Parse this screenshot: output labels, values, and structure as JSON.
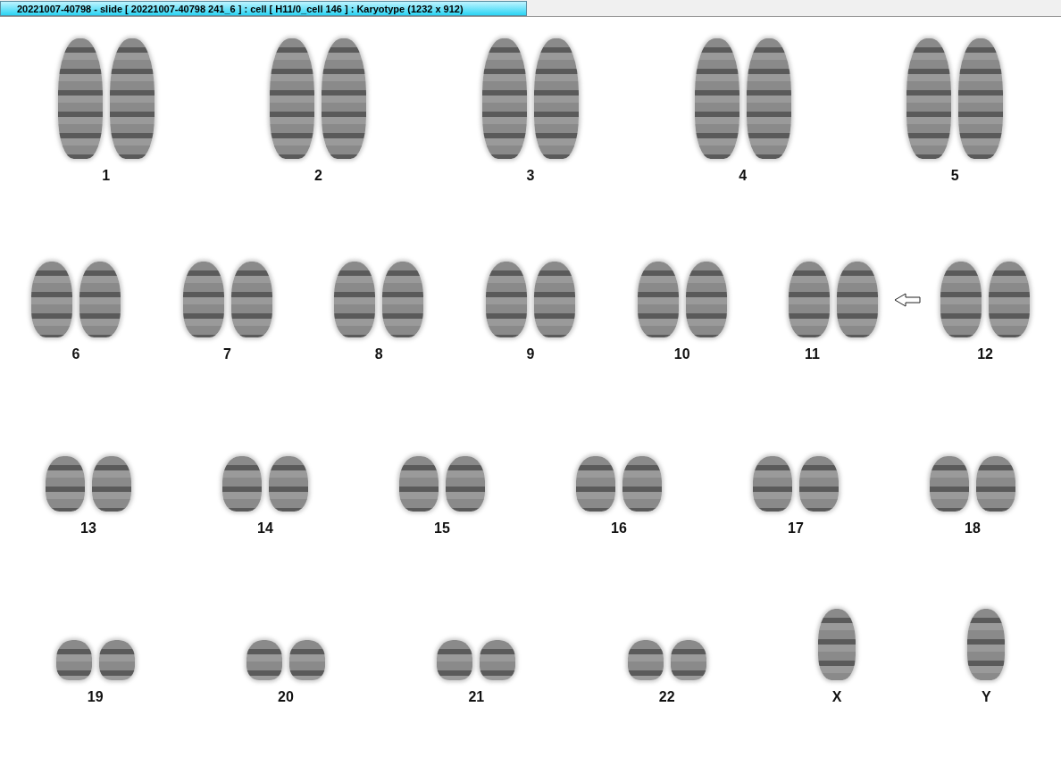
{
  "window": {
    "title": "20221007-40798 - slide [ 20221007-40798 241_6 ] : cell [ H11/0_cell 146 ] : Karyotype  (1232 x 912)"
  },
  "rows": [
    {
      "items": [
        {
          "label": "1",
          "kind": "pair",
          "marked": false
        },
        {
          "label": "2",
          "kind": "pair",
          "marked": false
        },
        {
          "label": "3",
          "kind": "pair",
          "marked": false
        },
        {
          "label": "4",
          "kind": "pair",
          "marked": false
        },
        {
          "label": "5",
          "kind": "pair",
          "marked": false
        }
      ]
    },
    {
      "items": [
        {
          "label": "6",
          "kind": "pair",
          "marked": false
        },
        {
          "label": "7",
          "kind": "pair",
          "marked": false
        },
        {
          "label": "8",
          "kind": "pair",
          "marked": false
        },
        {
          "label": "9",
          "kind": "pair",
          "marked": false
        },
        {
          "label": "10",
          "kind": "pair",
          "marked": false
        },
        {
          "label": "11",
          "kind": "pair",
          "marked": true
        },
        {
          "label": "12",
          "kind": "pair",
          "marked": false
        }
      ]
    },
    {
      "items": [
        {
          "label": "13",
          "kind": "pair",
          "marked": false
        },
        {
          "label": "14",
          "kind": "pair",
          "marked": false
        },
        {
          "label": "15",
          "kind": "pair",
          "marked": false
        },
        {
          "label": "16",
          "kind": "pair",
          "marked": false
        },
        {
          "label": "17",
          "kind": "pair",
          "marked": false
        },
        {
          "label": "18",
          "kind": "pair",
          "marked": false
        }
      ]
    },
    {
      "items": [
        {
          "label": "19",
          "kind": "pair",
          "marked": false
        },
        {
          "label": "20",
          "kind": "pair",
          "marked": false
        },
        {
          "label": "21",
          "kind": "pair",
          "marked": false
        },
        {
          "label": "22",
          "kind": "pair",
          "marked": false
        },
        {
          "label": "X",
          "kind": "single",
          "marked": false
        },
        {
          "label": "Y",
          "kind": "single",
          "marked": false
        }
      ]
    }
  ]
}
